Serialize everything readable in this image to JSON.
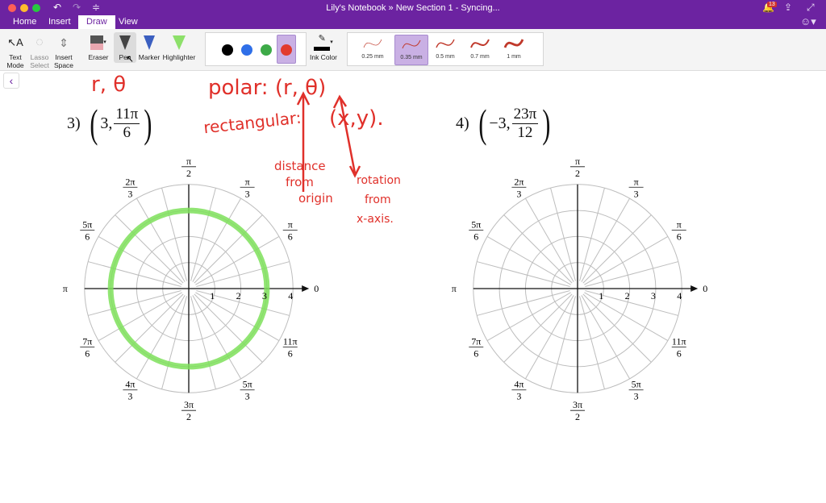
{
  "window": {
    "title": "Lily's Notebook  »  New Section 1 - Syncing...",
    "notification_count": "13"
  },
  "tabs": [
    {
      "label": "Home"
    },
    {
      "label": "Insert"
    },
    {
      "label": "Draw"
    },
    {
      "label": "View"
    }
  ],
  "active_tab": "Draw",
  "toolbar": {
    "text_mode": [
      "Text",
      "Mode"
    ],
    "lasso": [
      "Lasso",
      "Select"
    ],
    "insert_space": [
      "Insert",
      "Space"
    ],
    "eraser": "Eraser",
    "pen": "Pen",
    "marker": "Marker",
    "highlighter": "Highlighter",
    "ink_color": "Ink Color",
    "colors": [
      "#000000",
      "#2f6fe8",
      "#3daa48",
      "#e23b2e"
    ],
    "selected_color": "#e23b2e",
    "widths": [
      {
        "label": "0.25 mm"
      },
      {
        "label": "0.35 mm"
      },
      {
        "label": "0.5 mm"
      },
      {
        "label": "0.7 mm"
      },
      {
        "label": "1 mm"
      }
    ],
    "selected_width": "0.35 mm"
  },
  "problems": [
    {
      "number": "3)",
      "r": "3,",
      "theta_num": "11π",
      "theta_den": "6"
    },
    {
      "number": "4)",
      "r": "−3,",
      "theta_num": "23π",
      "theta_den": "12"
    }
  ],
  "polar_grid": {
    "rings": [
      1,
      2,
      3,
      4
    ],
    "radial_labels": [
      "1",
      "2",
      "3",
      "4"
    ],
    "angle_labels": [
      {
        "deg": 0,
        "num": "0",
        "den": ""
      },
      {
        "deg": 30,
        "num": "π",
        "den": "6"
      },
      {
        "deg": 60,
        "num": "π",
        "den": "3"
      },
      {
        "deg": 90,
        "num": "π",
        "den": "2"
      },
      {
        "deg": 120,
        "num": "2π",
        "den": "3"
      },
      {
        "deg": 150,
        "num": "5π",
        "den": "6"
      },
      {
        "deg": 180,
        "num": "π",
        "den": ""
      },
      {
        "deg": 210,
        "num": "7π",
        "den": "6"
      },
      {
        "deg": 240,
        "num": "4π",
        "den": "3"
      },
      {
        "deg": 270,
        "num": "3π",
        "den": "2"
      },
      {
        "deg": 300,
        "num": "5π",
        "den": "3"
      },
      {
        "deg": 330,
        "num": "11π",
        "den": "6"
      }
    ],
    "spoke_step_deg": 15,
    "highlight": {
      "graph": 0,
      "r": 3,
      "color": "#7ee05a"
    }
  },
  "ink": {
    "r_theta": "r, θ",
    "polar": "polar: (r, θ)",
    "rectangular": "rectangular:",
    "xy": "(x,y).",
    "distance": [
      "distance",
      "from",
      "origin"
    ],
    "rotation": [
      "rotation",
      "from",
      "x-axis."
    ]
  }
}
